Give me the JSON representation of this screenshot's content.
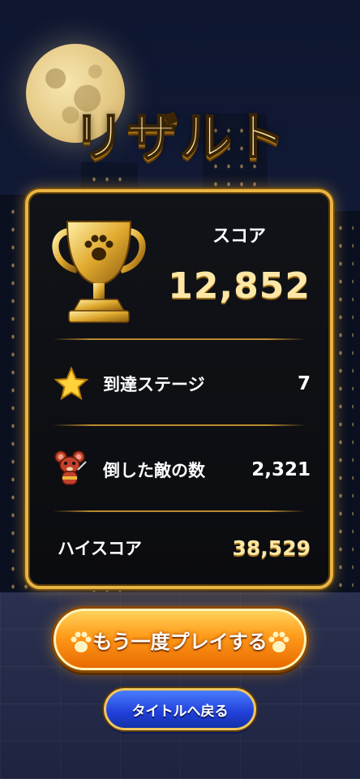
{
  "screen_title": "リザルト",
  "score": {
    "label": "スコア",
    "value": "12,852"
  },
  "stats": [
    {
      "icon": "star-icon",
      "label": "到達ステージ",
      "value": "7"
    },
    {
      "icon": "mouse-enemy-icon",
      "label": "倒した敵の数",
      "value": "2,321"
    }
  ],
  "high_score": {
    "label": "ハイスコア",
    "value": "38,529"
  },
  "buttons": {
    "replay_label": "もう一度プレイする",
    "title_label": "タイトルへ戻る"
  },
  "colors": {
    "gold": "#e8b443",
    "orange": "#ff9a1a",
    "blue": "#1f3fd8"
  }
}
